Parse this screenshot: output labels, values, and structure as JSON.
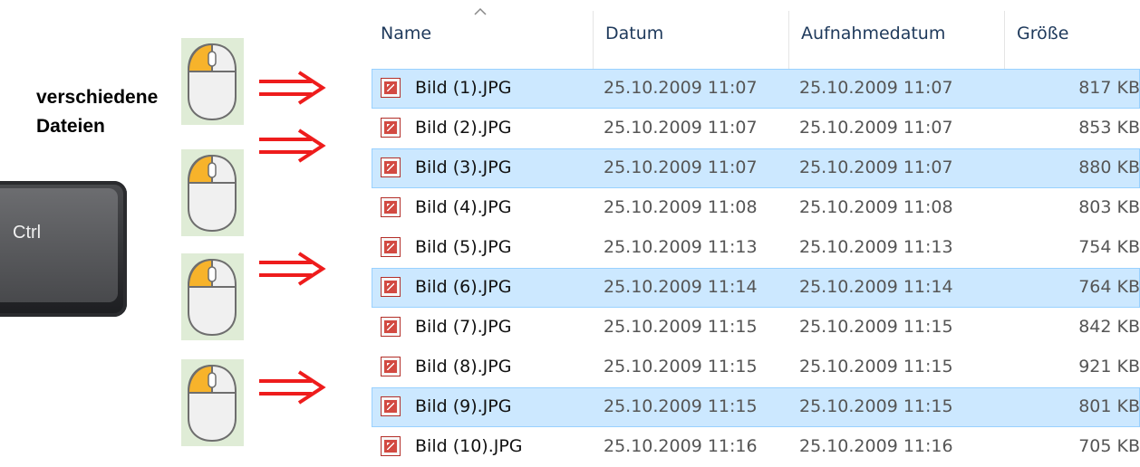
{
  "caption": {
    "line1": "verschiedene",
    "line2": "Dateien"
  },
  "ctrl_key": {
    "label": "Ctrl"
  },
  "columns": {
    "name": "Name",
    "date": "Datum",
    "taken": "Aufnahmedatum",
    "size": "Größe"
  },
  "files": [
    {
      "name": "Bild (1).JPG",
      "date": "25.10.2009 11:07",
      "taken": "25.10.2009 11:07",
      "size": "817 KB",
      "selected": true
    },
    {
      "name": "Bild (2).JPG",
      "date": "25.10.2009 11:07",
      "taken": "25.10.2009 11:07",
      "size": "853 KB",
      "selected": false
    },
    {
      "name": "Bild (3).JPG",
      "date": "25.10.2009 11:07",
      "taken": "25.10.2009 11:07",
      "size": "880 KB",
      "selected": true
    },
    {
      "name": "Bild (4).JPG",
      "date": "25.10.2009 11:08",
      "taken": "25.10.2009 11:08",
      "size": "803 KB",
      "selected": false
    },
    {
      "name": "Bild (5).JPG",
      "date": "25.10.2009 11:13",
      "taken": "25.10.2009 11:13",
      "size": "754 KB",
      "selected": false
    },
    {
      "name": "Bild (6).JPG",
      "date": "25.10.2009 11:14",
      "taken": "25.10.2009 11:14",
      "size": "764 KB",
      "selected": true
    },
    {
      "name": "Bild (7).JPG",
      "date": "25.10.2009 11:15",
      "taken": "25.10.2009 11:15",
      "size": "842 KB",
      "selected": false
    },
    {
      "name": "Bild (8).JPG",
      "date": "25.10.2009 11:15",
      "taken": "25.10.2009 11:15",
      "size": "921 KB",
      "selected": false
    },
    {
      "name": "Bild (9).JPG",
      "date": "25.10.2009 11:15",
      "taken": "25.10.2009 11:15",
      "size": "801 KB",
      "selected": true
    },
    {
      "name": "Bild (10).JPG",
      "date": "25.10.2009 11:16",
      "taken": "25.10.2009 11:16",
      "size": "705 KB",
      "selected": false
    }
  ],
  "colors": {
    "selection": "#cce8ff",
    "selection_border": "#99d1ff",
    "arrow": "#ee1c1c",
    "mouse_button": "#f7b32b",
    "mouse_box": "#dfecd6"
  }
}
